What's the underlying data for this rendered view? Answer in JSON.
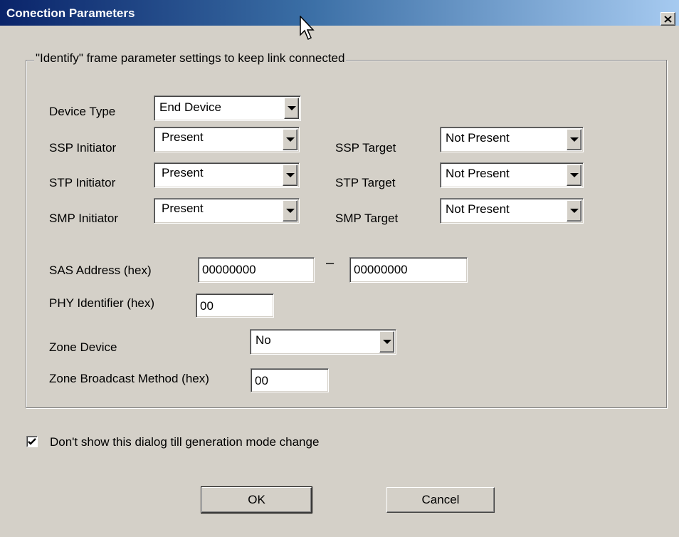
{
  "window": {
    "title": "Conection Parameters"
  },
  "group": {
    "legend": "\"Identify\" frame parameter settings to keep link connected"
  },
  "fields": {
    "device_type": {
      "label": "Device Type",
      "value": "End Device"
    },
    "ssp_initiator": {
      "label": "SSP Initiator",
      "value": "Present"
    },
    "stp_initiator": {
      "label": "STP Initiator",
      "value": "Present"
    },
    "smp_initiator": {
      "label": "SMP Initiator",
      "value": "Present"
    },
    "ssp_target": {
      "label": "SSP Target",
      "value": "Not Present"
    },
    "stp_target": {
      "label": "STP Target",
      "value": "Not Present"
    },
    "smp_target": {
      "label": "SMP Target",
      "value": "Not Present"
    },
    "sas_address": {
      "label": "SAS Address (hex)",
      "high": "00000000",
      "separator": "–",
      "low": "00000000"
    },
    "phy_identifier": {
      "label": "PHY Identifier (hex)",
      "value": "00"
    },
    "zone_device": {
      "label": "Zone Device",
      "value": "No"
    },
    "zone_broadcast": {
      "label": "Zone Broadcast Method (hex)",
      "value": "00"
    }
  },
  "checkbox": {
    "label": "Don't show this dialog till generation mode change",
    "checked": true
  },
  "buttons": {
    "ok": "OK",
    "cancel": "Cancel"
  }
}
